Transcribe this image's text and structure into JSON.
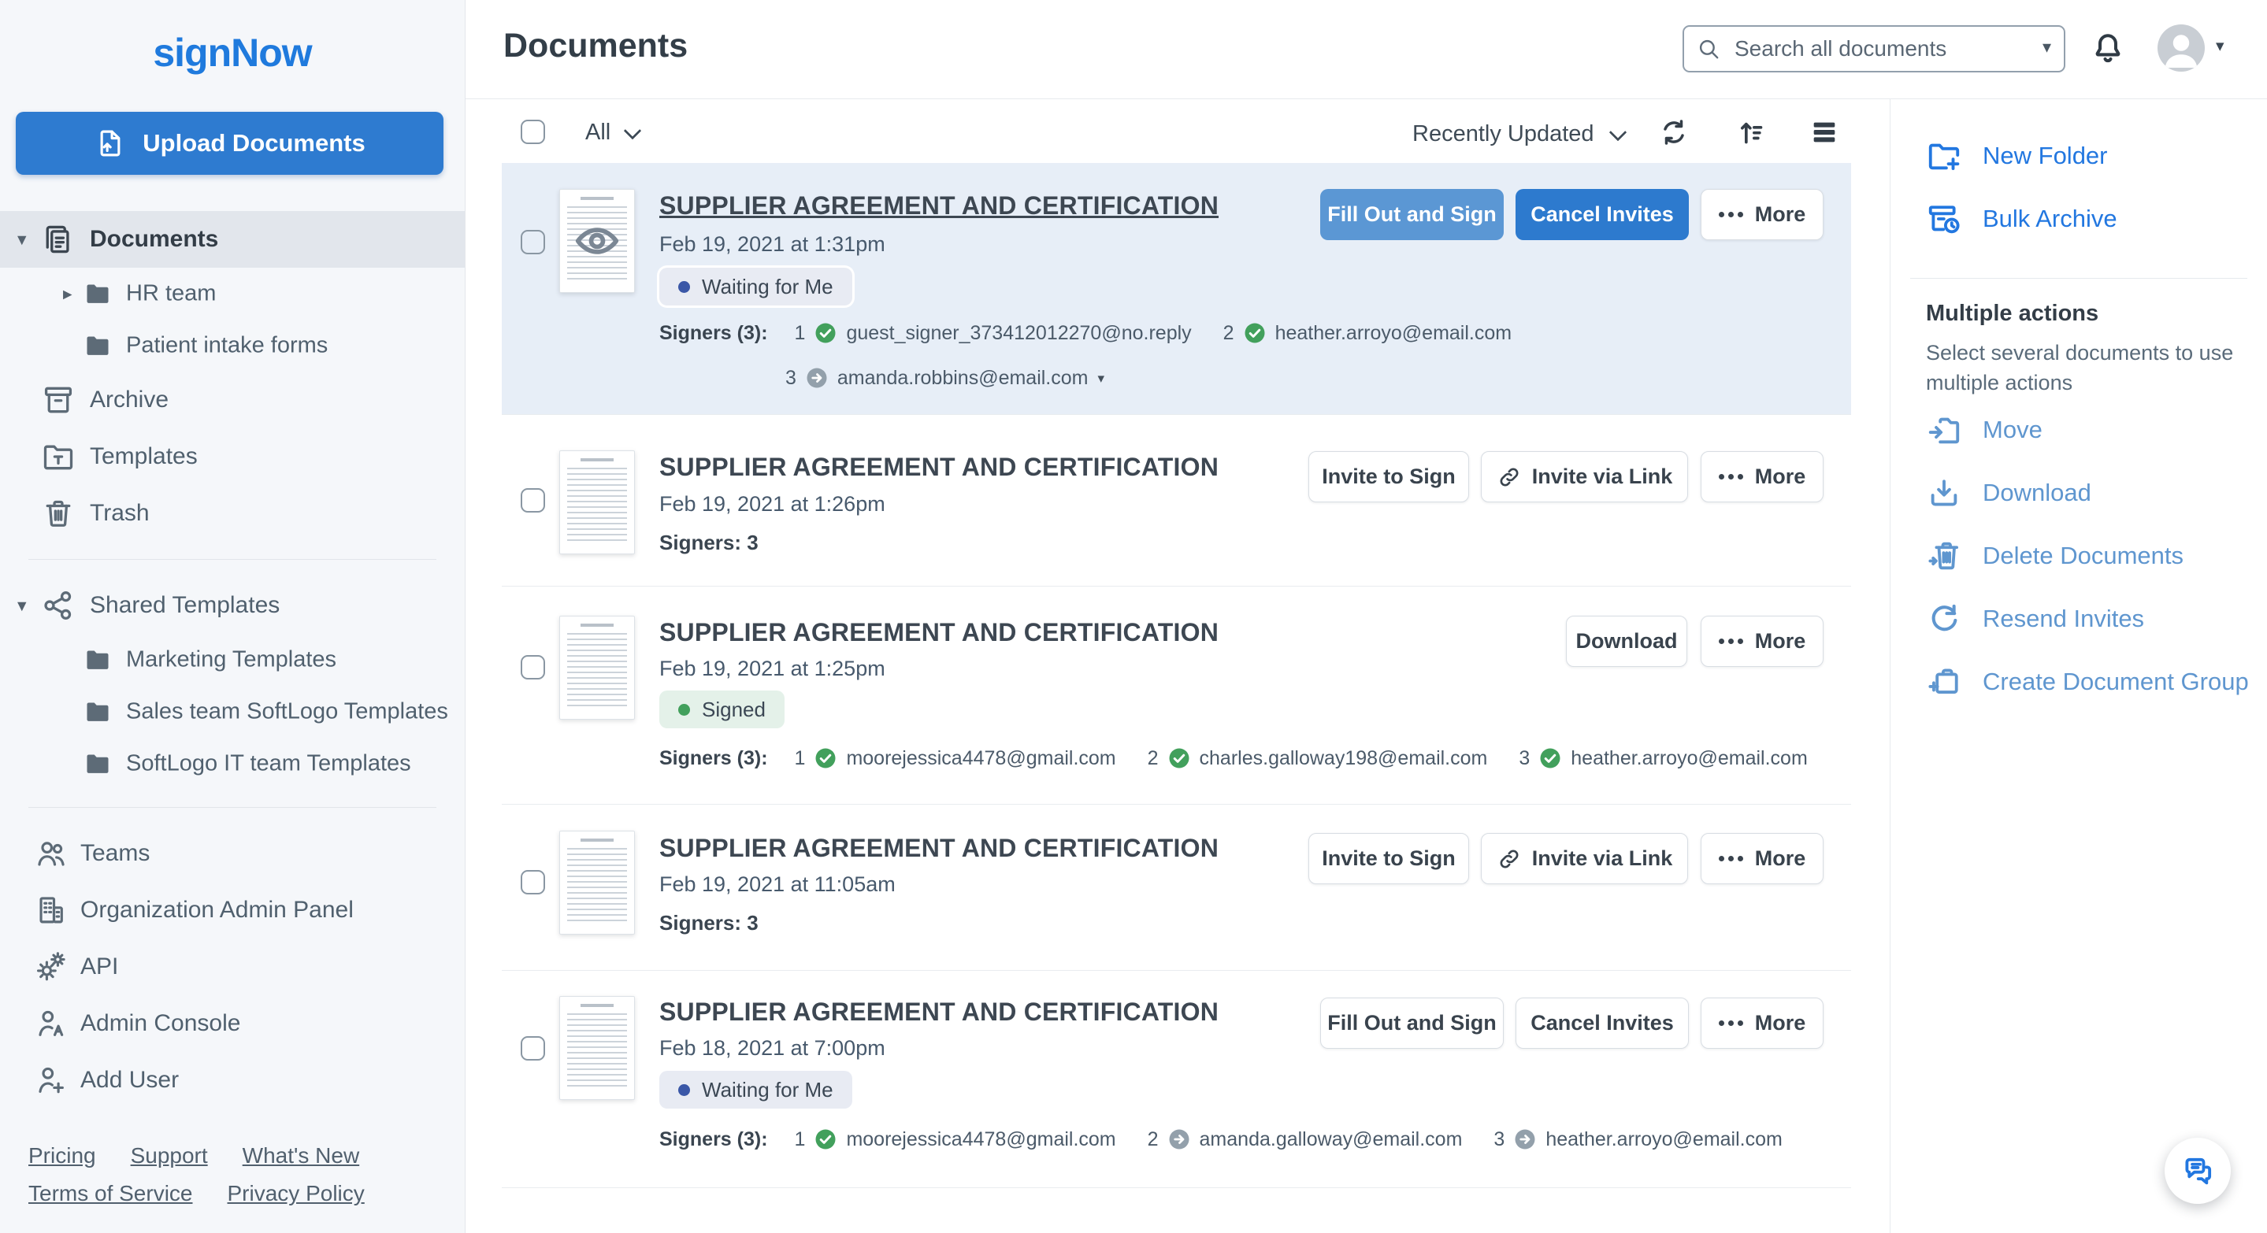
{
  "brand": {
    "logo": "signNow"
  },
  "header": {
    "title": "Documents",
    "search_placeholder": "Search all documents"
  },
  "sidebar": {
    "upload": "Upload Documents",
    "documents": "Documents",
    "hr_team": "HR team",
    "patient_intake_forms": "Patient intake forms",
    "archive": "Archive",
    "templates": "Templates",
    "trash": "Trash",
    "shared_templates": "Shared Templates",
    "marketing_templates": "Marketing Templates",
    "sales_team_softlogo_templates": "Sales team SoftLogo Templates",
    "softlogo_it_team_templates": "SoftLogo IT team Templates",
    "teams": "Teams",
    "organization_admin_panel": "Organization Admin Panel",
    "api": "API",
    "admin_console": "Admin Console",
    "add_user": "Add User",
    "footer": {
      "pricing": "Pricing",
      "support": "Support",
      "whats_new": "What's New",
      "terms_of_service": "Terms of Service",
      "privacy_policy": "Privacy Policy"
    }
  },
  "toolbar": {
    "select_filter": "All",
    "sort": "Recently Updated"
  },
  "list": {
    "rows": [
      {
        "title": "SUPPLIER AGREEMENT AND CERTIFICATION",
        "date": "Feb 19, 2021 at 1:31pm",
        "badge": "Waiting for Me",
        "signers_label": "Signers (3):",
        "signers": [
          {
            "num": "1",
            "email": "guest_signer_373412012270@no.reply",
            "status": "signed"
          },
          {
            "num": "2",
            "email": "heather.arroyo@email.com",
            "status": "signed"
          },
          {
            "num": "3",
            "email": "amanda.robbins@email.com",
            "status": "pending"
          }
        ],
        "buttons": {
          "primary": "Fill Out and Sign",
          "secondary": "Cancel Invites",
          "more": "More"
        }
      },
      {
        "title": "SUPPLIER AGREEMENT AND CERTIFICATION",
        "date": "Feb 19, 2021 at 1:26pm",
        "signers_summary": "Signers: 3",
        "buttons": {
          "invite": "Invite to Sign",
          "invite_link": "Invite via Link",
          "more": "More"
        }
      },
      {
        "title": "SUPPLIER AGREEMENT AND CERTIFICATION",
        "date": "Feb 19, 2021 at 1:25pm",
        "badge": "Signed",
        "signers_label": "Signers (3):",
        "signers": [
          {
            "num": "1",
            "email": "moorejessica4478@gmail.com",
            "status": "signed"
          },
          {
            "num": "2",
            "email": "charles.galloway198@email.com",
            "status": "signed"
          },
          {
            "num": "3",
            "email": "heather.arroyo@email.com",
            "status": "signed"
          }
        ],
        "buttons": {
          "download": "Download",
          "more": "More"
        }
      },
      {
        "title": "SUPPLIER AGREEMENT AND CERTIFICATION",
        "date": "Feb 19, 2021 at 11:05am",
        "signers_summary": "Signers: 3",
        "buttons": {
          "invite": "Invite to Sign",
          "invite_link": "Invite via Link",
          "more": "More"
        }
      },
      {
        "title": "SUPPLIER AGREEMENT AND CERTIFICATION",
        "date": "Feb 18, 2021 at 7:00pm",
        "badge": "Waiting for Me",
        "signers_label": "Signers (3):",
        "signers": [
          {
            "num": "1",
            "email": "moorejessica4478@gmail.com",
            "status": "signed"
          },
          {
            "num": "2",
            "email": "amanda.galloway@email.com",
            "status": "pending"
          },
          {
            "num": "3",
            "email": "heather.arroyo@email.com",
            "status": "pending"
          }
        ],
        "buttons": {
          "primary": "Fill Out and Sign",
          "secondary": "Cancel Invites",
          "more": "More"
        }
      }
    ]
  },
  "right_panel": {
    "new_folder": "New Folder",
    "bulk_archive": "Bulk Archive",
    "multiple_actions_title": "Multiple actions",
    "multiple_actions_hint": "Select several documents to use multiple actions",
    "move": "Move",
    "download": "Download",
    "delete_documents": "Delete Documents",
    "resend_invites": "Resend Invites",
    "create_document_group": "Create Document Group"
  },
  "colors": {
    "brand_blue": "#1f7add",
    "primary_button_blue": "#2d7ace",
    "light_button_blue": "#5b97d4",
    "selected_row_bg": "#e7eef7",
    "signed_green": "#42a05c",
    "pending_gray": "#93a0ab",
    "waiting_dot_blue": "#3a57a7",
    "panel_link_bright": "#2277e0",
    "panel_link_soft": "#5f96cf"
  }
}
